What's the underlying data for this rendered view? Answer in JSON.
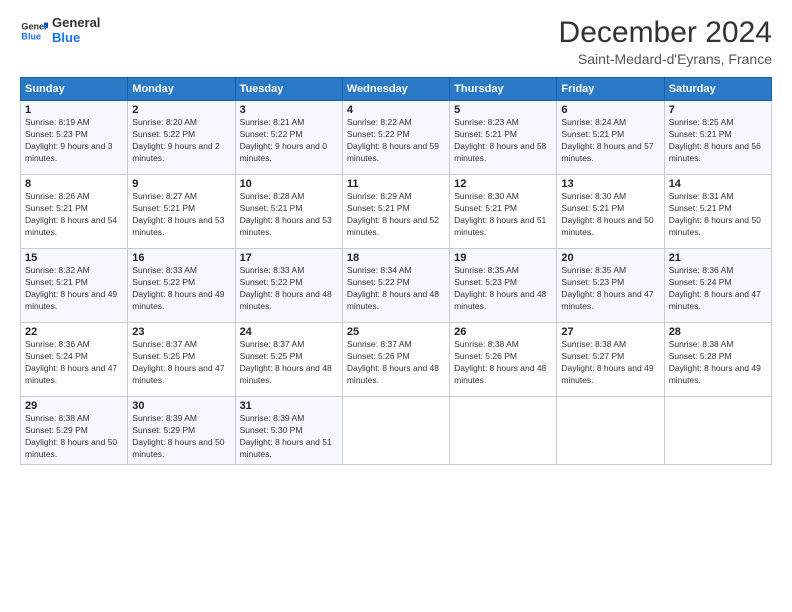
{
  "logo": {
    "line1": "General",
    "line2": "Blue"
  },
  "header": {
    "month": "December 2024",
    "location": "Saint-Medard-d'Eyrans, France"
  },
  "weekdays": [
    "Sunday",
    "Monday",
    "Tuesday",
    "Wednesday",
    "Thursday",
    "Friday",
    "Saturday"
  ],
  "weeks": [
    [
      {
        "day": "1",
        "sunrise": "8:19 AM",
        "sunset": "5:23 PM",
        "daylight": "9 hours and 3 minutes."
      },
      {
        "day": "2",
        "sunrise": "8:20 AM",
        "sunset": "5:22 PM",
        "daylight": "9 hours and 2 minutes."
      },
      {
        "day": "3",
        "sunrise": "8:21 AM",
        "sunset": "5:22 PM",
        "daylight": "9 hours and 0 minutes."
      },
      {
        "day": "4",
        "sunrise": "8:22 AM",
        "sunset": "5:22 PM",
        "daylight": "8 hours and 59 minutes."
      },
      {
        "day": "5",
        "sunrise": "8:23 AM",
        "sunset": "5:21 PM",
        "daylight": "8 hours and 58 minutes."
      },
      {
        "day": "6",
        "sunrise": "8:24 AM",
        "sunset": "5:21 PM",
        "daylight": "8 hours and 57 minutes."
      },
      {
        "day": "7",
        "sunrise": "8:25 AM",
        "sunset": "5:21 PM",
        "daylight": "8 hours and 56 minutes."
      }
    ],
    [
      {
        "day": "8",
        "sunrise": "8:26 AM",
        "sunset": "5:21 PM",
        "daylight": "8 hours and 54 minutes."
      },
      {
        "day": "9",
        "sunrise": "8:27 AM",
        "sunset": "5:21 PM",
        "daylight": "8 hours and 53 minutes."
      },
      {
        "day": "10",
        "sunrise": "8:28 AM",
        "sunset": "5:21 PM",
        "daylight": "8 hours and 53 minutes."
      },
      {
        "day": "11",
        "sunrise": "8:29 AM",
        "sunset": "5:21 PM",
        "daylight": "8 hours and 52 minutes."
      },
      {
        "day": "12",
        "sunrise": "8:30 AM",
        "sunset": "5:21 PM",
        "daylight": "8 hours and 51 minutes."
      },
      {
        "day": "13",
        "sunrise": "8:30 AM",
        "sunset": "5:21 PM",
        "daylight": "8 hours and 50 minutes."
      },
      {
        "day": "14",
        "sunrise": "8:31 AM",
        "sunset": "5:21 PM",
        "daylight": "8 hours and 50 minutes."
      }
    ],
    [
      {
        "day": "15",
        "sunrise": "8:32 AM",
        "sunset": "5:21 PM",
        "daylight": "8 hours and 49 minutes."
      },
      {
        "day": "16",
        "sunrise": "8:33 AM",
        "sunset": "5:22 PM",
        "daylight": "8 hours and 49 minutes."
      },
      {
        "day": "17",
        "sunrise": "8:33 AM",
        "sunset": "5:22 PM",
        "daylight": "8 hours and 48 minutes."
      },
      {
        "day": "18",
        "sunrise": "8:34 AM",
        "sunset": "5:22 PM",
        "daylight": "8 hours and 48 minutes."
      },
      {
        "day": "19",
        "sunrise": "8:35 AM",
        "sunset": "5:23 PM",
        "daylight": "8 hours and 48 minutes."
      },
      {
        "day": "20",
        "sunrise": "8:35 AM",
        "sunset": "5:23 PM",
        "daylight": "8 hours and 47 minutes."
      },
      {
        "day": "21",
        "sunrise": "8:36 AM",
        "sunset": "5:24 PM",
        "daylight": "8 hours and 47 minutes."
      }
    ],
    [
      {
        "day": "22",
        "sunrise": "8:36 AM",
        "sunset": "5:24 PM",
        "daylight": "8 hours and 47 minutes."
      },
      {
        "day": "23",
        "sunrise": "8:37 AM",
        "sunset": "5:25 PM",
        "daylight": "8 hours and 47 minutes."
      },
      {
        "day": "24",
        "sunrise": "8:37 AM",
        "sunset": "5:25 PM",
        "daylight": "8 hours and 48 minutes."
      },
      {
        "day": "25",
        "sunrise": "8:37 AM",
        "sunset": "5:26 PM",
        "daylight": "8 hours and 48 minutes."
      },
      {
        "day": "26",
        "sunrise": "8:38 AM",
        "sunset": "5:26 PM",
        "daylight": "8 hours and 48 minutes."
      },
      {
        "day": "27",
        "sunrise": "8:38 AM",
        "sunset": "5:27 PM",
        "daylight": "8 hours and 49 minutes."
      },
      {
        "day": "28",
        "sunrise": "8:38 AM",
        "sunset": "5:28 PM",
        "daylight": "8 hours and 49 minutes."
      }
    ],
    [
      {
        "day": "29",
        "sunrise": "8:38 AM",
        "sunset": "5:29 PM",
        "daylight": "8 hours and 50 minutes."
      },
      {
        "day": "30",
        "sunrise": "8:39 AM",
        "sunset": "5:29 PM",
        "daylight": "8 hours and 50 minutes."
      },
      {
        "day": "31",
        "sunrise": "8:39 AM",
        "sunset": "5:30 PM",
        "daylight": "8 hours and 51 minutes."
      },
      null,
      null,
      null,
      null
    ]
  ],
  "labels": {
    "sunrise": "Sunrise:",
    "sunset": "Sunset:",
    "daylight": "Daylight:"
  }
}
